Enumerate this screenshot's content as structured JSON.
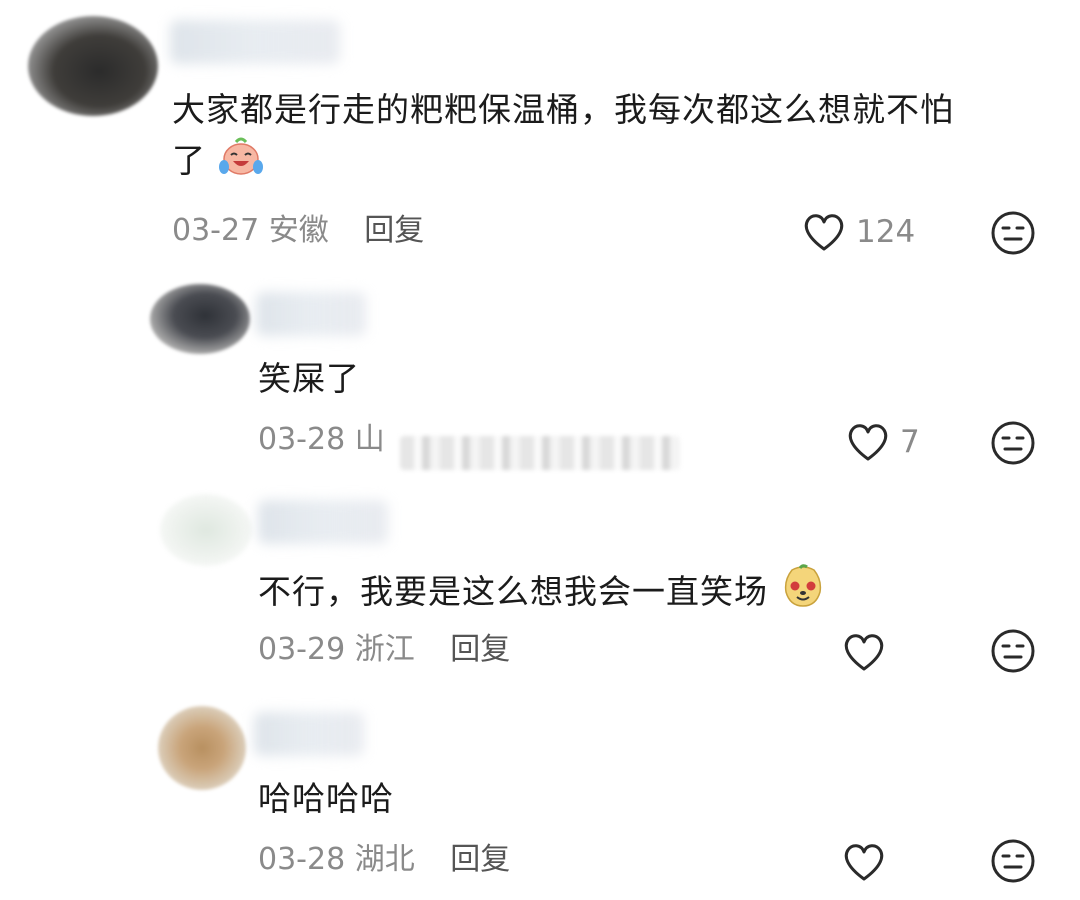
{
  "comments": [
    {
      "text_line1": "大家都是行走的粑粑保温桶，我每次都这么想就不怕",
      "text_line2": "了",
      "date": "03-27",
      "region": "安徽",
      "reply_label": "回复",
      "likes": "124"
    },
    {
      "text": "笑屎了",
      "date": "03-28",
      "region_partial": "山",
      "likes": "7"
    },
    {
      "text": "不行，我要是这么想我会一直笑场",
      "date": "03-29",
      "region": "浙江",
      "reply_label": "回复",
      "likes": ""
    },
    {
      "text": "哈哈哈哈",
      "date": "03-28",
      "region": "湖北",
      "reply_label": "回复",
      "likes": ""
    }
  ],
  "colors": {
    "text": "#1b1b1b",
    "meta": "#8a8a8a",
    "icon_stroke": "#2a2a2a"
  },
  "icons": {
    "like": "heart-outline-icon",
    "dislike": "neutral-face-icon",
    "emoji1": "crying-laughing-emoji",
    "emoji2": "laughing-dog-emoji"
  }
}
